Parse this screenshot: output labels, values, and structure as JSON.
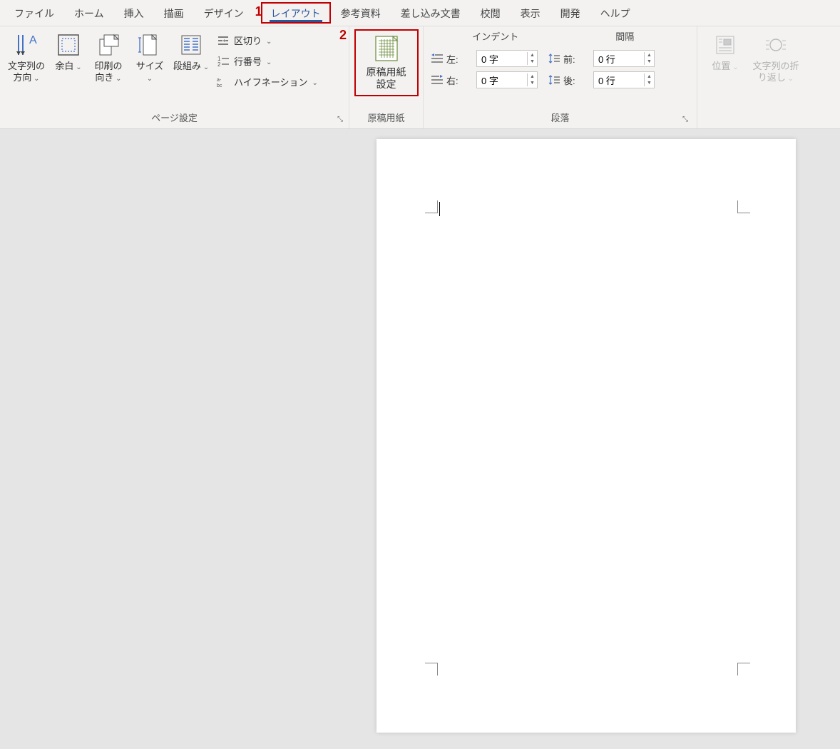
{
  "tabs": {
    "file": "ファイル",
    "home": "ホーム",
    "insert": "挿入",
    "draw": "描画",
    "design": "デザイン",
    "layout": "レイアウト",
    "references": "参考資料",
    "mailings": "差し込み文書",
    "review": "校閲",
    "view": "表示",
    "developer": "開発",
    "help": "ヘルプ"
  },
  "callouts": {
    "one": "1",
    "two": "2"
  },
  "page_setup": {
    "text_direction": "文字列の\n方向",
    "margins": "余白",
    "orientation": "印刷の\n向き",
    "size": "サイズ",
    "columns": "段組み",
    "breaks": "区切り",
    "line_numbers": "行番号",
    "hyphenation": "ハイフネーション",
    "group_label": "ページ設定"
  },
  "genko": {
    "button": "原稿用紙\n設定",
    "group_label": "原稿用紙"
  },
  "paragraph": {
    "indent_header": "インデント",
    "spacing_header": "間隔",
    "left_label": "左:",
    "right_label": "右:",
    "before_label": "前:",
    "after_label": "後:",
    "left_value": "0 字",
    "right_value": "0 字",
    "before_value": "0 行",
    "after_value": "0 行",
    "group_label": "段落"
  },
  "arrange": {
    "position": "位置",
    "wrap": "文字列の折\nり返し"
  }
}
